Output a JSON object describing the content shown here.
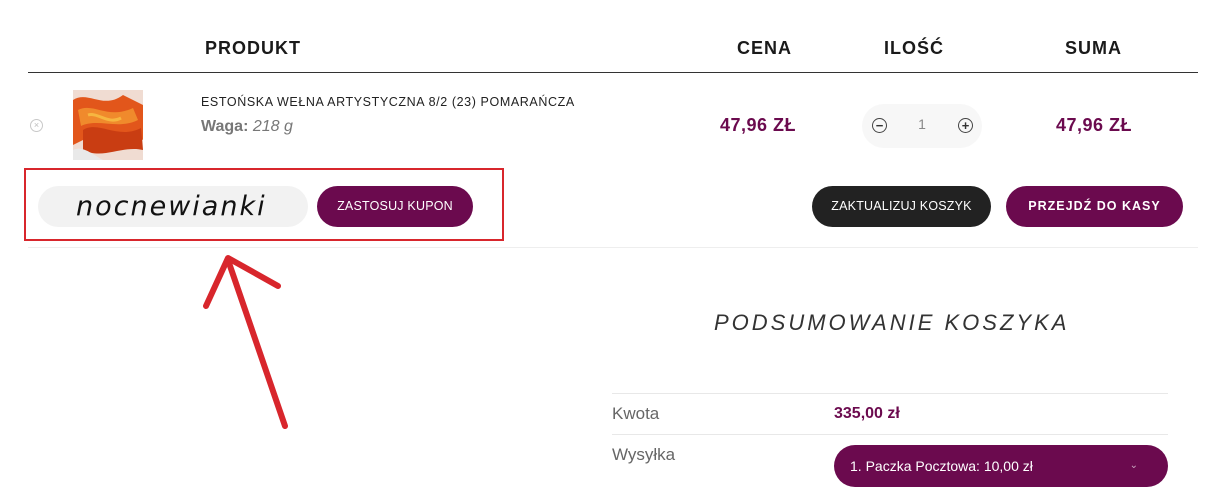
{
  "table": {
    "headers": {
      "product": "PRODUKT",
      "price": "CENA",
      "quantity": "ILOŚĆ",
      "total": "SUMA"
    }
  },
  "cart_item": {
    "remove_icon": "close-circle-icon",
    "name": "ESTOŃSKA WEŁNA ARTYSTYCZNA 8/2 (23) POMARAŃCZA",
    "variant_label": "Waga:",
    "variant_value": "218 g",
    "price": "47,96 ZŁ",
    "quantity": "1",
    "minus_icon": "minus-circle-icon",
    "plus_icon": "plus-circle-icon",
    "subtotal": "47,96 ZŁ"
  },
  "coupon": {
    "value": "nocnewianki",
    "apply_label": "ZASTOSUJ KUPON"
  },
  "actions": {
    "update_label": "ZAKTUALIZUJ KOSZYK",
    "checkout_label": "PRZEJDŹ DO KASY"
  },
  "summary": {
    "title": "PODSUMOWANIE KOSZYKA",
    "amount_label": "Kwota",
    "amount_value": "335,00 zł",
    "shipping_label": "Wysyłka",
    "shipping_selected": "1. Paczka Pocztowa: 10,00 zł"
  },
  "colors": {
    "accent": "#6b0a4e",
    "dark_button": "#222222",
    "annotation_red": "#d8262c"
  }
}
